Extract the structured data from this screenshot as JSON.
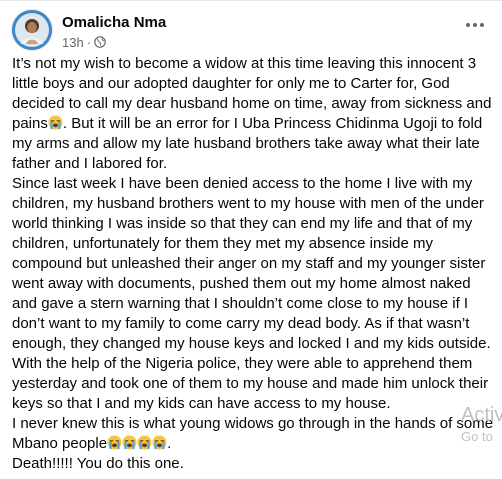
{
  "post": {
    "author": "Omalicha Nma",
    "time": "13h",
    "separator": "·",
    "privacy_icon": "globe-icon",
    "menu_icon": "more-options-icon",
    "paragraphs": [
      {
        "text": "It’s not my wish to become a widow at this time leaving this innocent 3 little boys and our adopted daughter for only me to Carter for, God decided to call my dear husband home on time, away from  sickness and pains",
        "emoji": [
          "loudly-crying-face-icon"
        ],
        "tail": ". But it will be an error for I Uba Princess Chidinma Ugoji to fold my arms and allow my late husband brothers take away what their late father and I labored for."
      },
      {
        "text": "Since last week I have been denied access to the home I live with my children, my husband brothers went to my house with men of the under world thinking I was inside so that they can end my life and that of my children, unfortunately for them they met my absence inside my compound but unleashed their anger on my staff and my younger sister went away with documents, pushed them out my home almost naked and gave a stern warning that I shouldn’t come close to my house if I don’t want to my family to come carry my dead body. As if that wasn’t enough, they changed my house keys and locked I and my kids outside. With the help of the Nigeria police, they were able to apprehend them yesterday and took one of them to my house and made him unlock their keys so that I and my kids can have access to my house.",
        "emoji": [],
        "tail": ""
      },
      {
        "text": "I never knew this is what young widows go through in the hands of some Mbano people",
        "emoji": [
          "loudly-crying-face-icon",
          "loudly-crying-face-icon",
          "loudly-crying-face-icon",
          "loudly-crying-face-icon"
        ],
        "tail": "."
      },
      {
        "text": "Death!!!!! You do this one.",
        "emoji": [],
        "tail": ""
      }
    ]
  },
  "watermark": {
    "line1": "Activ",
    "line2": "Go to"
  },
  "colors": {
    "text": "#050505",
    "secondary_text": "#65676b",
    "avatar_ring": "#3f87c8",
    "watermark": "#bfc1c4"
  }
}
